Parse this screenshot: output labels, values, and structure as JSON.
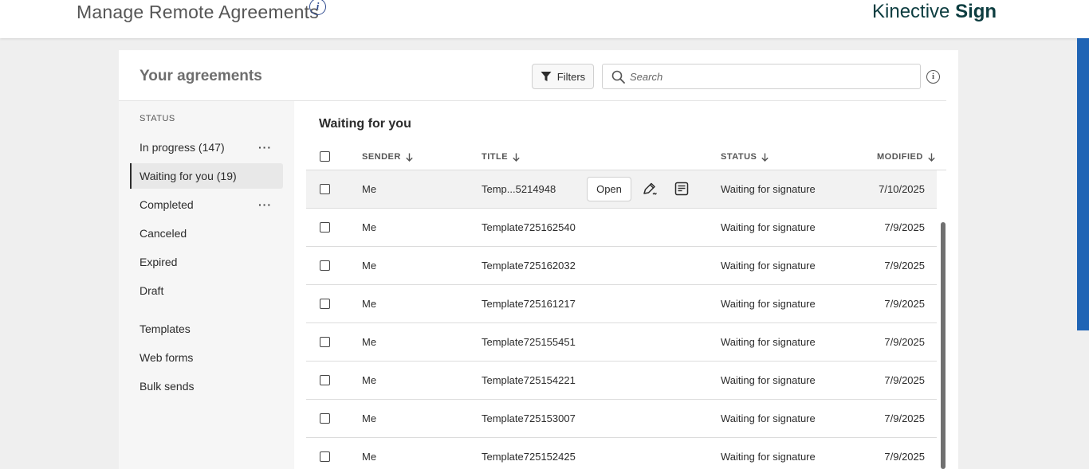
{
  "header": {
    "page_title": "Manage Remote Agreements",
    "info_glyph": "i",
    "brand_light": "Kinective",
    "brand_bold": "Sign",
    "accent_color": "#1f64b5"
  },
  "panel": {
    "title": "Your agreements",
    "filters_label": "Filters",
    "search_placeholder": "Search",
    "info_glyph": "i"
  },
  "sidebar": {
    "status_label": "STATUS",
    "items": [
      {
        "label": "In progress (147)",
        "more": "···"
      },
      {
        "label": "Waiting for you (19)"
      },
      {
        "label": "Completed",
        "more": "···"
      },
      {
        "label": "Canceled"
      },
      {
        "label": "Expired"
      },
      {
        "label": "Draft"
      },
      {
        "label": "Templates"
      },
      {
        "label": "Web forms"
      },
      {
        "label": "Bulk sends"
      }
    ],
    "active_index": 1
  },
  "table": {
    "section_title": "Waiting for you",
    "columns": {
      "sender": "SENDER",
      "title": "TITLE",
      "status": "STATUS",
      "modified": "MODIFIED"
    },
    "open_label": "Open",
    "rows": [
      {
        "sender": "Me",
        "title": "Temp...5214948",
        "status": "Waiting for signature",
        "modified": "7/10/2025"
      },
      {
        "sender": "Me",
        "title": "Template725162540",
        "status": "Waiting for signature",
        "modified": "7/9/2025"
      },
      {
        "sender": "Me",
        "title": "Template725162032",
        "status": "Waiting for signature",
        "modified": "7/9/2025"
      },
      {
        "sender": "Me",
        "title": "Template725161217",
        "status": "Waiting for signature",
        "modified": "7/9/2025"
      },
      {
        "sender": "Me",
        "title": "Template725155451",
        "status": "Waiting for signature",
        "modified": "7/9/2025"
      },
      {
        "sender": "Me",
        "title": "Template725154221",
        "status": "Waiting for signature",
        "modified": "7/9/2025"
      },
      {
        "sender": "Me",
        "title": "Template725153007",
        "status": "Waiting for signature",
        "modified": "7/9/2025"
      },
      {
        "sender": "Me",
        "title": "Template725152425",
        "status": "Waiting for signature",
        "modified": "7/9/2025"
      }
    ]
  }
}
